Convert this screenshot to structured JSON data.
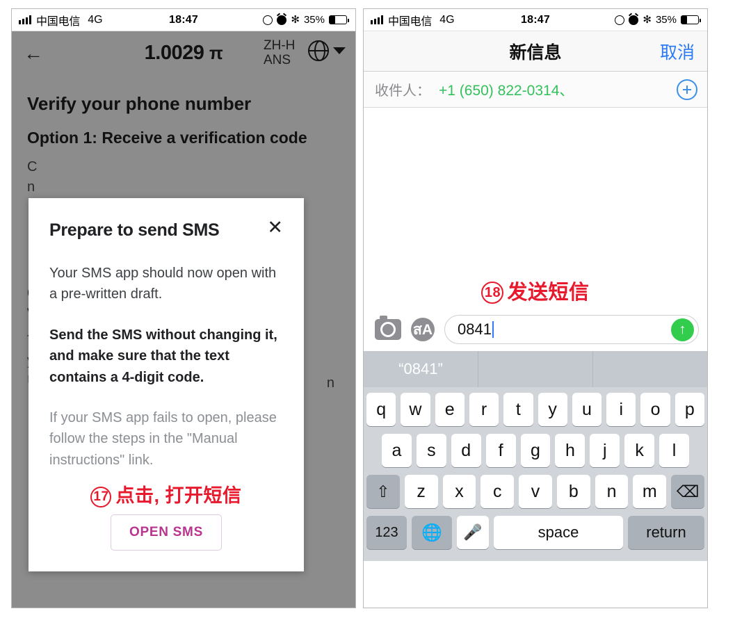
{
  "left_phone": {
    "status_bar": {
      "carrier": "中国电信",
      "network": "4G",
      "time": "18:47",
      "battery_percent": "35%",
      "icons": [
        "signal-bars-icon",
        "rotation-lock-icon",
        "alarm-clock-icon",
        "bluetooth-icon",
        "battery-icon"
      ]
    },
    "app_bar": {
      "back_icon": "←",
      "title_number": "1.0029",
      "title_symbol": "π",
      "language": "ZH-HANS",
      "globe_icon": "globe-icon",
      "caret_icon": "▼"
    },
    "page": {
      "heading": "Verify your phone number",
      "subheading": "Option 1: Receive a verification code",
      "body_line_1": "C",
      "body_line_2": "n",
      "section2_line_1": "C",
      "section2_line_2": "v",
      "tail_line_1": "T",
      "tail_line_2": "y",
      "tail_line_3": "U",
      "tail_fragment_right": "n",
      "manual_link": "Manual instructions"
    },
    "modal": {
      "title": "Prepare to send SMS",
      "close_icon": "✕",
      "paragraph_1": "Your SMS app should now open with a pre-written draft.",
      "paragraph_2": "Send the SMS without changing it, and make sure that the text contains a 4-digit code.",
      "paragraph_3": "If your SMS app fails to open, please follow the steps in the \"Manual instructions\" link.",
      "annotation_number": "17",
      "annotation_text": "点击, 打开短信",
      "button_label": "OPEN SMS"
    }
  },
  "right_phone": {
    "status_bar": {
      "carrier": "中国电信",
      "network": "4G",
      "time": "18:47",
      "battery_percent": "35%"
    },
    "nav": {
      "title": "新信息",
      "cancel": "取消"
    },
    "recipient": {
      "label": "收件人：",
      "value": "+1 (650) 822-0314、",
      "add_icon": "plus-circle-icon"
    },
    "annotation": {
      "number": "18",
      "text": "发送短信"
    },
    "compose": {
      "camera_icon": "camera-icon",
      "appstore_icon": "appstore-icon",
      "message_value": "0841",
      "send_icon": "↑"
    },
    "keyboard": {
      "predictions": [
        "“0841”",
        "",
        ""
      ],
      "row1": [
        "q",
        "w",
        "e",
        "r",
        "t",
        "y",
        "u",
        "i",
        "o",
        "p"
      ],
      "row2": [
        "a",
        "s",
        "d",
        "f",
        "g",
        "h",
        "j",
        "k",
        "l"
      ],
      "row3": [
        "z",
        "x",
        "c",
        "v",
        "b",
        "n",
        "m"
      ],
      "shift_icon": "⇧",
      "delete_icon": "⌫",
      "numbers_key": "123",
      "globe_key": "globe-icon",
      "mic_key": "mic-icon",
      "space_key": "space",
      "return_key": "return"
    }
  },
  "colors": {
    "accent_blue": "#2b7bf6",
    "green_phone": "#33c15b",
    "send_green": "#32cd4c",
    "annotation_red": "#e8192c",
    "open_sms_purple": "#b8348f",
    "backdrop_gray": "#8c8c8c"
  }
}
